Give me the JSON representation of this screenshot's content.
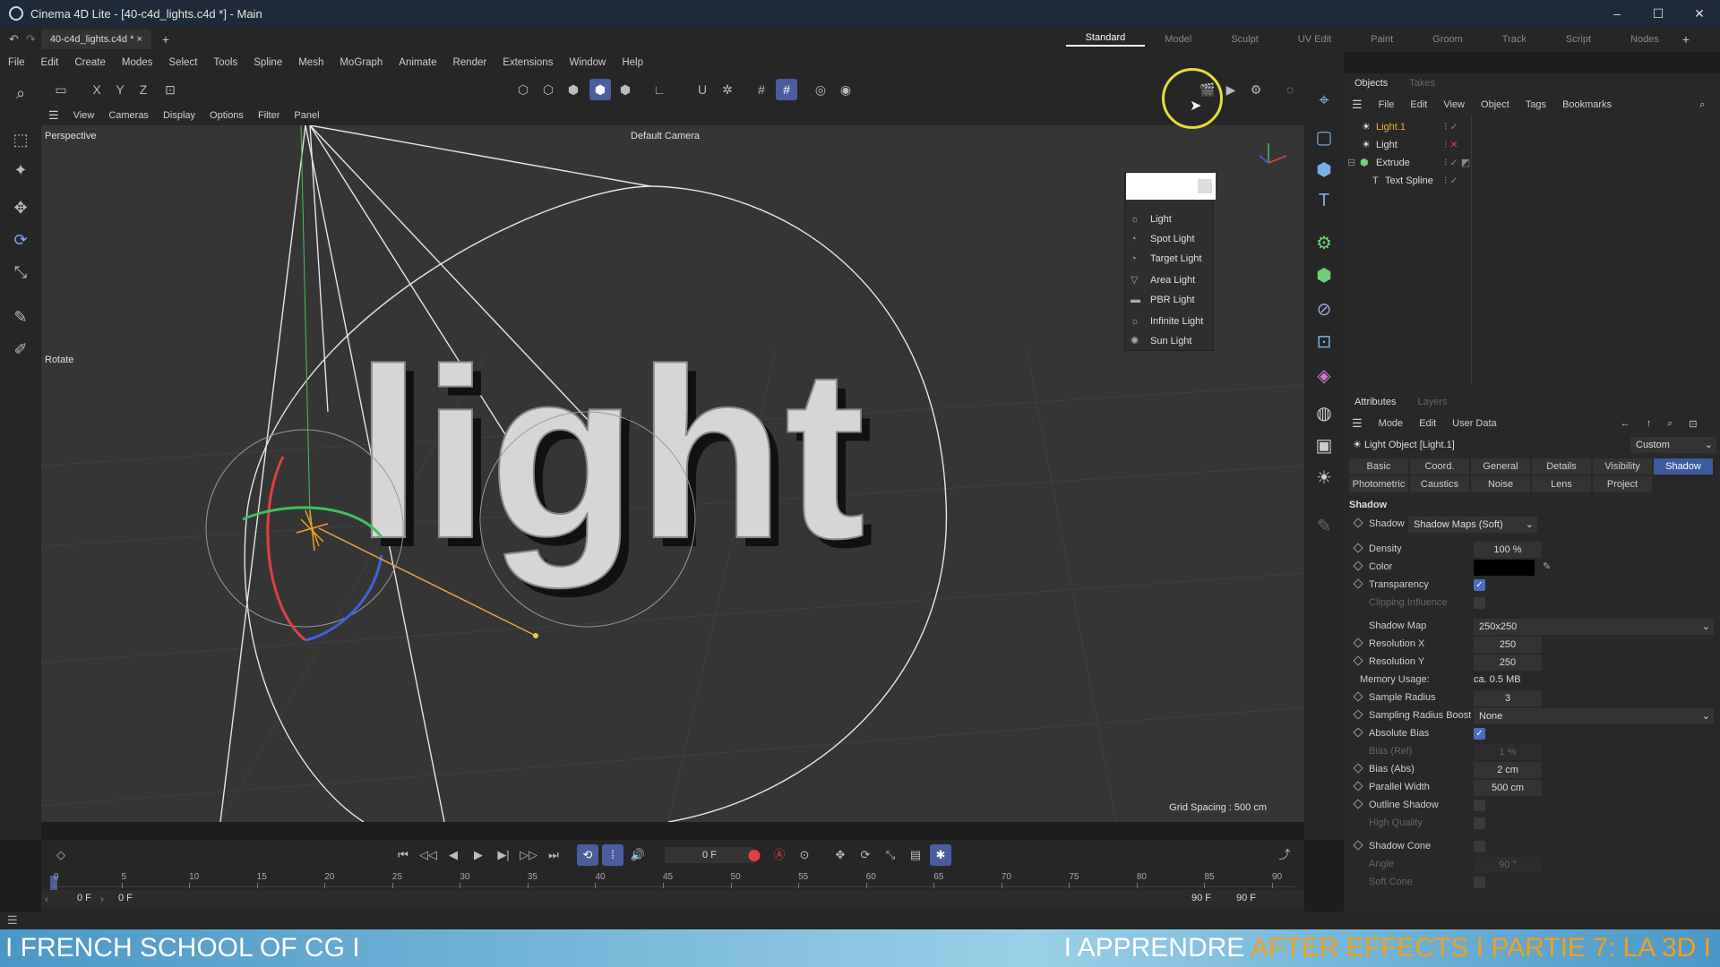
{
  "window": {
    "title": "Cinema 4D Lite - [40-c4d_lights.c4d *] - Main",
    "controls": [
      "–",
      "☐",
      "✕"
    ]
  },
  "doc_tab": {
    "label": "40-c4d_lights.c4d *",
    "close": "×",
    "add": "+"
  },
  "layouts": [
    "Standard",
    "Model",
    "Sculpt",
    "UV Edit",
    "Paint",
    "Groom",
    "Track",
    "Script",
    "Nodes"
  ],
  "menu": [
    "File",
    "Edit",
    "Create",
    "Modes",
    "Select",
    "Tools",
    "Spline",
    "Mesh",
    "MoGraph",
    "Animate",
    "Render",
    "Extensions",
    "Window",
    "Help"
  ],
  "toolbar_axes": [
    "X",
    "Y",
    "Z"
  ],
  "viewport": {
    "menu": [
      "View",
      "Cameras",
      "Display",
      "Options",
      "Filter",
      "Panel"
    ],
    "label": "Perspective",
    "camera": "Default Camera",
    "tool_label": "Rotate",
    "grid_spacing": "Grid Spacing : 500 cm",
    "text_3d": "light"
  },
  "light_menu": [
    "Light",
    "Spot Light",
    "Target Light",
    "Area Light",
    "PBR Light",
    "Infinite Light",
    "Sun Light"
  ],
  "objects_panel": {
    "tabs": [
      "Objects",
      "Takes"
    ],
    "menu": [
      "File",
      "Edit",
      "View",
      "Object",
      "Tags",
      "Bookmarks"
    ],
    "items": [
      {
        "name": "Light.1",
        "selected": true
      },
      {
        "name": "Light",
        "selected": false
      },
      {
        "name": "Extrude",
        "selected": false
      },
      {
        "name": "Text Spline",
        "selected": false
      }
    ]
  },
  "attributes": {
    "tabs": [
      "Attributes",
      "Layers"
    ],
    "menu": [
      "Mode",
      "Edit",
      "User Data"
    ],
    "object_title": "Light Object [Light.1]",
    "preset": "Custom",
    "prop_tabs_row1": [
      "Basic",
      "Coord.",
      "General",
      "Details",
      "Visibility",
      "Shadow"
    ],
    "prop_tabs_row2": [
      "Photometric",
      "Caustics",
      "Noise",
      "Lens",
      "Project"
    ],
    "active_tab": "Shadow",
    "section": "Shadow",
    "shadow_type": "Shadow Maps (Soft)",
    "density": {
      "label": "Density",
      "value": "100 %"
    },
    "color_label": "Color",
    "transparency": "Transparency",
    "clipping": "Clipping Influence",
    "shadow_map": {
      "label": "Shadow Map",
      "value": "250x250"
    },
    "res_x": {
      "label": "Resolution X",
      "value": "250"
    },
    "res_y": {
      "label": "Resolution Y",
      "value": "250"
    },
    "memory": {
      "label": "Memory Usage:",
      "value": "ca. 0.5 MB"
    },
    "sample_radius": {
      "label": "Sample Radius",
      "value": "3"
    },
    "sampling_boost": {
      "label": "Sampling Radius Boost",
      "value": "None"
    },
    "absolute_bias": "Absolute Bias",
    "bias_rel": {
      "label": "Bias (Rel)",
      "value": "1 %"
    },
    "bias_abs": {
      "label": "Bias (Abs)",
      "value": "2 cm"
    },
    "parallel_width": {
      "label": "Parallel Width",
      "value": "500 cm"
    },
    "outline_shadow": "Outline Shadow",
    "high_quality": "High Quality",
    "shadow_cone": "Shadow Cone",
    "angle": {
      "label": "Angle",
      "value": "90 °"
    },
    "soft_cone": "Soft Cone"
  },
  "timeline": {
    "current_frame": "0 F",
    "ruler": [
      "0",
      "5",
      "10",
      "15",
      "20",
      "25",
      "30",
      "35",
      "40",
      "45",
      "50",
      "55",
      "60",
      "65",
      "70",
      "75",
      "80",
      "85",
      "90"
    ],
    "start": "0 F",
    "start2": "0 F",
    "end": "90 F",
    "end2": "90 F"
  },
  "banner": {
    "left": "I FRENCH SCHOOL OF CG I",
    "right_a": "I APPRENDRE ",
    "right_b": "AFTER EFFECTS I PARTIE 7: LA 3D I"
  }
}
